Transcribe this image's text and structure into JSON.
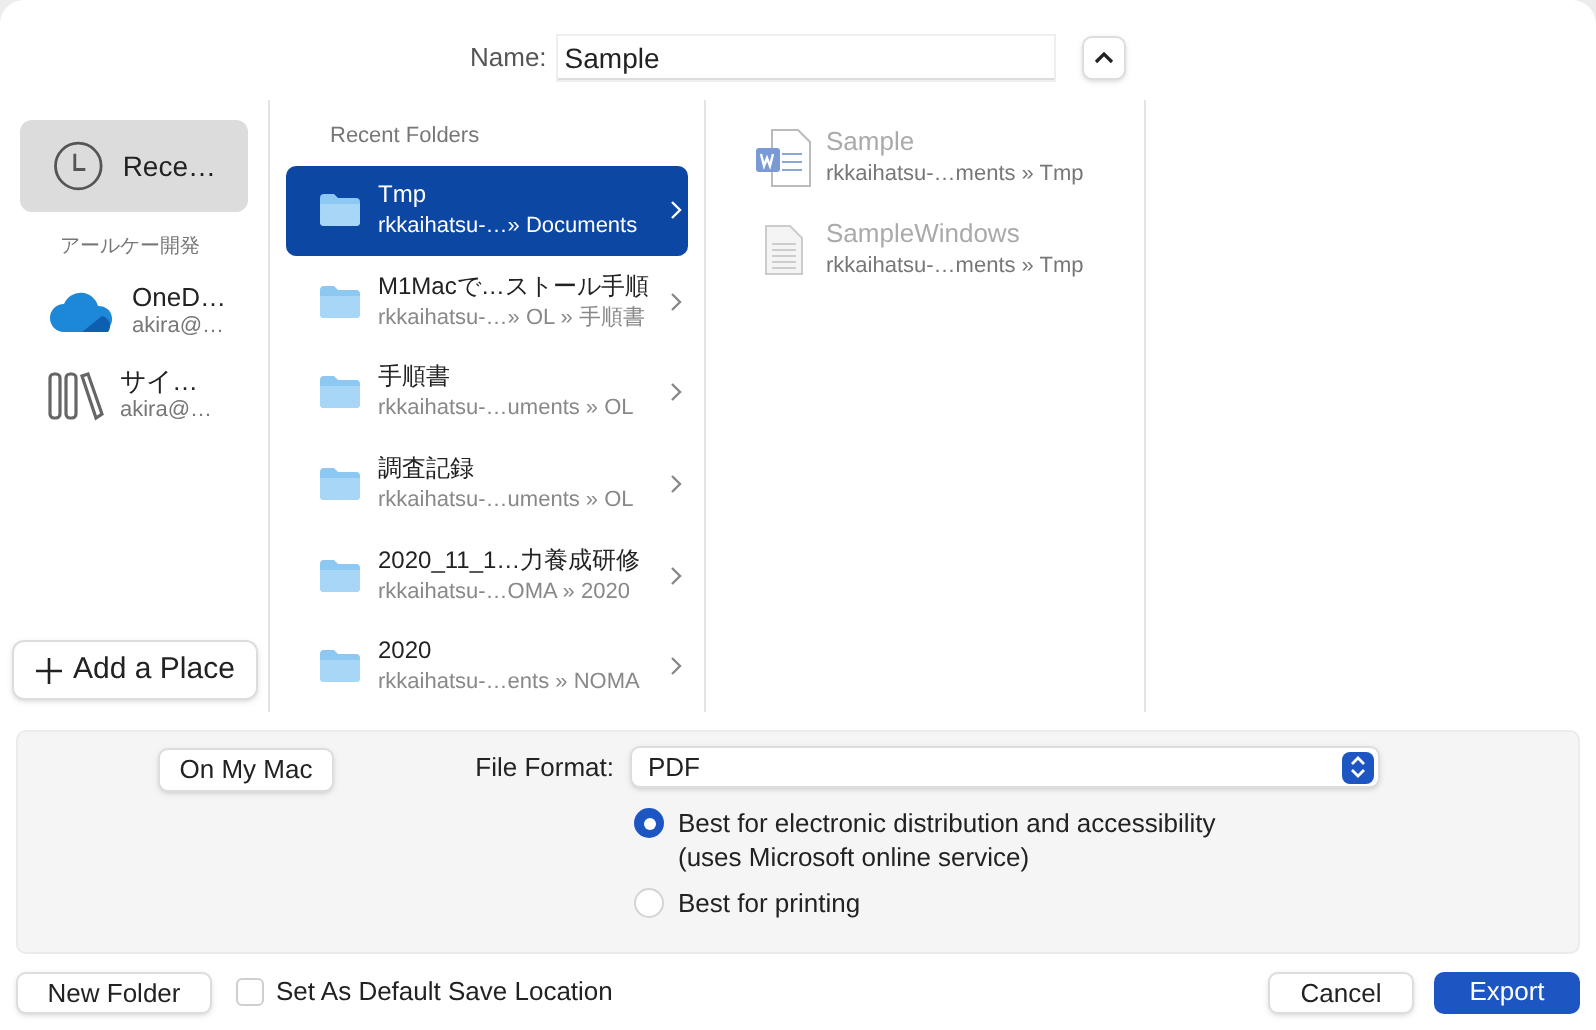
{
  "name_field": {
    "label": "Name:",
    "value": "Sample",
    "expanded": true
  },
  "sidebar": {
    "items": [
      {
        "kind": "recent",
        "title": "Rece…",
        "selected": true
      }
    ],
    "groups": [
      {
        "title": "アールケー開発",
        "items": [
          {
            "kind": "cloud",
            "title": "OneD…",
            "subtitle": "akira@…",
            "selected": false
          },
          {
            "kind": "library",
            "title": "サイ…",
            "subtitle": "akira@…",
            "selected": false
          }
        ]
      }
    ],
    "add_button": "Add a Place"
  },
  "folders": {
    "title": "Recent Folders",
    "items": [
      {
        "name": "Tmp",
        "path": "rkkaihatsu-…» Documents",
        "selected": true
      },
      {
        "name": "M1Macで…ストール手順",
        "path": "rkkaihatsu-…» OL » 手順書",
        "selected": false
      },
      {
        "name": "手順書",
        "path": "rkkaihatsu-…uments » OL",
        "selected": false
      },
      {
        "name": "調査記録",
        "path": "rkkaihatsu-…uments » OL",
        "selected": false
      },
      {
        "name": "2020_11_1…力養成研修",
        "path": "rkkaihatsu-…OMA » 2020",
        "selected": false
      },
      {
        "name": "2020",
        "path": "rkkaihatsu-…ents » NOMA",
        "selected": false
      }
    ]
  },
  "files": [
    {
      "kind": "word",
      "name": "Sample",
      "path": "rkkaihatsu-…ments » Tmp"
    },
    {
      "kind": "text",
      "name": "SampleWindows",
      "path": "rkkaihatsu-…ments » Tmp"
    }
  ],
  "options": {
    "location_button": "On My Mac",
    "format_label": "File Format:",
    "format_value": "PDF",
    "radios": [
      {
        "label": "Best for electronic distribution and accessibility",
        "note": "(uses Microsoft online service)",
        "selected": true
      },
      {
        "label": "Best for printing",
        "selected": false
      }
    ]
  },
  "footer": {
    "new_folder": "New Folder",
    "default_checkbox": {
      "label": "Set As Default Save Location",
      "checked": false
    },
    "cancel": "Cancel",
    "export": "Export"
  }
}
